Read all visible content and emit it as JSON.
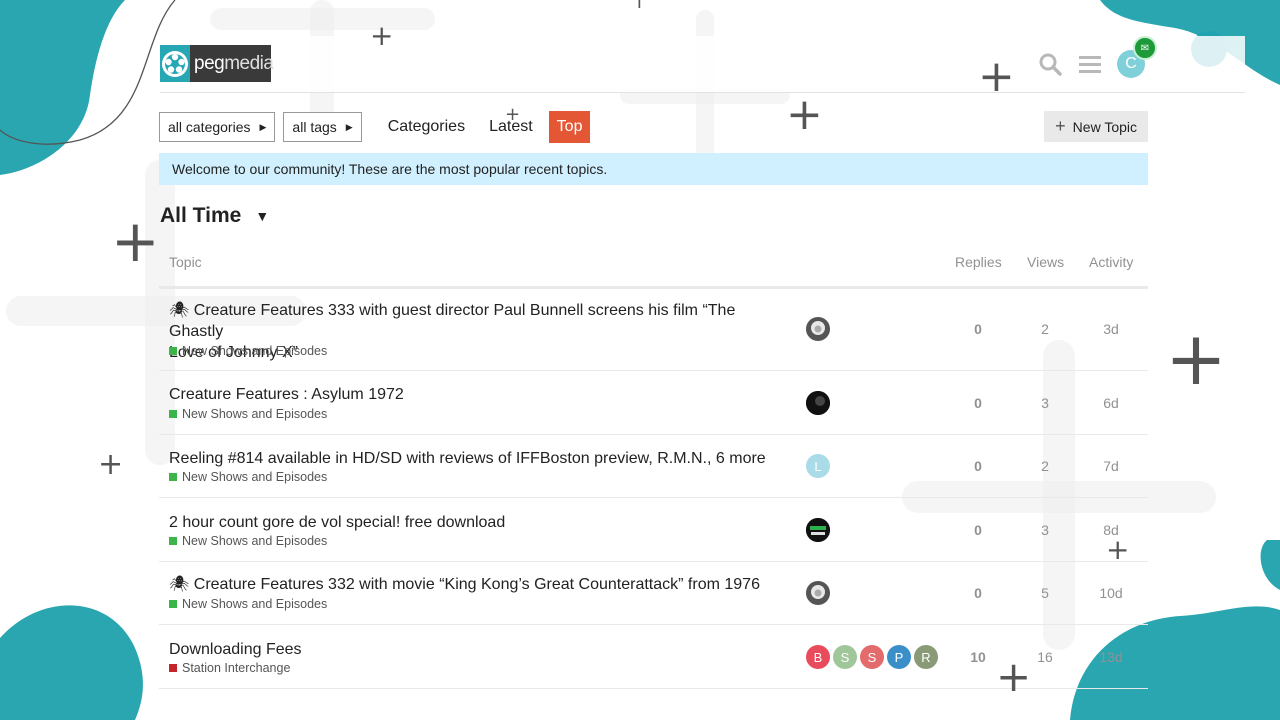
{
  "header": {
    "logo_text_a": "peg",
    "logo_text_b": "media",
    "user_initial": "C"
  },
  "nav": {
    "categories_dropdown": "all categories",
    "tags_dropdown": "all tags",
    "links": [
      "Categories",
      "Latest",
      "Top"
    ],
    "active": "Top",
    "new_topic": "New Topic"
  },
  "banner": "Welcome to our community! These are the most popular recent topics.",
  "period": "All Time",
  "columns": {
    "topic": "Topic",
    "replies": "Replies",
    "views": "Views",
    "activity": "Activity"
  },
  "topics": [
    {
      "title_1": "🕷 Creature Features 333 with guest director Paul Bunnell screens his film “The Ghastly",
      "title_2": "Love of Johnny X”",
      "category": "New Shows and Episodes",
      "category_color": "#3ab54a",
      "replies": "0",
      "views": "2",
      "activity": "3d"
    },
    {
      "title_1": "Creature Features : Asylum 1972",
      "category": "New Shows and Episodes",
      "category_color": "#3ab54a",
      "replies": "0",
      "views": "3",
      "activity": "6d"
    },
    {
      "title_1": "Reeling #814 available in HD/SD with reviews of IFFBoston preview, R.M.N., 6 more",
      "category": "New Shows and Episodes",
      "category_color": "#3ab54a",
      "replies": "0",
      "views": "2",
      "activity": "7d",
      "avatar_letter": "L"
    },
    {
      "title_1": "2 hour count gore de vol special! free download",
      "category": "New Shows and Episodes",
      "category_color": "#3ab54a",
      "replies": "0",
      "views": "3",
      "activity": "8d"
    },
    {
      "title_1": "🕷 Creature Features 332 with movie “King Kong’s Great Counterattack” from 1976",
      "category": "New Shows and Episodes",
      "category_color": "#3ab54a",
      "replies": "0",
      "views": "5",
      "activity": "10d"
    },
    {
      "title_1": "Downloading Fees",
      "category": "Station Interchange",
      "category_color": "#c3252b",
      "replies": "10",
      "views": "16",
      "activity": "13d",
      "avatar_letters": [
        "B",
        "S",
        "S",
        "P",
        "R"
      ]
    }
  ]
}
